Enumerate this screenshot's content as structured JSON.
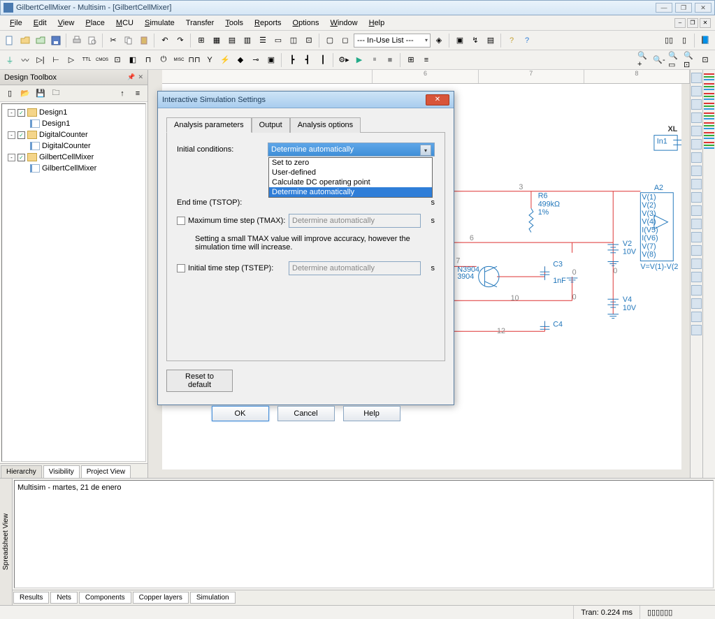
{
  "app": {
    "title": "GilbertCellMixer - Multisim - [GilbertCellMixer]"
  },
  "menus": [
    "File",
    "Edit",
    "View",
    "Place",
    "MCU",
    "Simulate",
    "Transfer",
    "Tools",
    "Reports",
    "Options",
    "Window",
    "Help"
  ],
  "toolbar_dropdown": "--- In-Use List ---",
  "design_toolbox": {
    "title": "Design Toolbox",
    "tree": [
      {
        "indent": 0,
        "toggle": "-",
        "check": true,
        "icon": "folder",
        "label": "Design1"
      },
      {
        "indent": 1,
        "toggle": "",
        "check": false,
        "icon": "doc",
        "label": "Design1"
      },
      {
        "indent": 0,
        "toggle": "-",
        "check": true,
        "icon": "folder",
        "label": "DigitalCounter"
      },
      {
        "indent": 1,
        "toggle": "",
        "check": false,
        "icon": "doc",
        "label": "DigitalCounter"
      },
      {
        "indent": 0,
        "toggle": "-",
        "check": true,
        "icon": "folder",
        "label": "GilbertCellMixer"
      },
      {
        "indent": 1,
        "toggle": "",
        "check": false,
        "icon": "doc",
        "label": "GilbertCellMixer"
      }
    ],
    "tabs": [
      "Hierarchy",
      "Visibility",
      "Project View"
    ]
  },
  "ruler_top": [
    "6",
    "7",
    "8"
  ],
  "circuit": {
    "resistor": {
      "name": "R6",
      "value": "499kΩ",
      "tol": "1%"
    },
    "cap1": {
      "name": "C3",
      "value": "1nF"
    },
    "cap2": {
      "name": "C4",
      "value": ""
    },
    "v1": {
      "name": "V2",
      "value": "10V"
    },
    "v2": {
      "name": "V4",
      "value": "10V"
    },
    "trans": {
      "name": "N3904",
      "model": "3904"
    },
    "module": {
      "name": "A2",
      "signals": [
        "V(1)",
        "V(2)",
        "V(3)",
        "V(4)",
        "I(V5)",
        "I(V6)",
        "V(7)",
        "V(8)"
      ],
      "eq": "V=V(1)-V(2"
    },
    "nets": {
      "n3": "3",
      "n6": "6",
      "n7": "7",
      "n10": "10",
      "n0a": "0",
      "n0b": "0",
      "n0c": "0",
      "n12": "12"
    }
  },
  "log": {
    "text": "Multisim - martes, 21 de enero"
  },
  "bottom_tabs": [
    "Results",
    "Nets",
    "Components",
    "Copper layers",
    "Simulation"
  ],
  "spreadsheet_tab": "Spreadsheet View",
  "status": {
    "tran": "Tran: 0.224 ms"
  },
  "dialog": {
    "title": "Interactive Simulation Settings",
    "tabs": [
      "Analysis parameters",
      "Output",
      "Analysis options"
    ],
    "labels": {
      "initial": "Initial conditions:",
      "endtime": "End time (TSTOP):",
      "maxstep": "Maximum time step (TMAX):",
      "hint": "Setting a small TMAX value will improve accuracy, however the simulation time will increase.",
      "initstep": "Initial time step (TSTEP):",
      "unit": "s"
    },
    "values": {
      "initial": "Determine automatically",
      "options": [
        "Set to zero",
        "User-defined",
        "Calculate DC operating point",
        "Determine automatically"
      ],
      "maxstep": "Determine automatically",
      "initstep": "Determine automatically"
    },
    "buttons": {
      "reset": "Reset to default",
      "ok": "OK",
      "cancel": "Cancel",
      "help": "Help"
    }
  }
}
